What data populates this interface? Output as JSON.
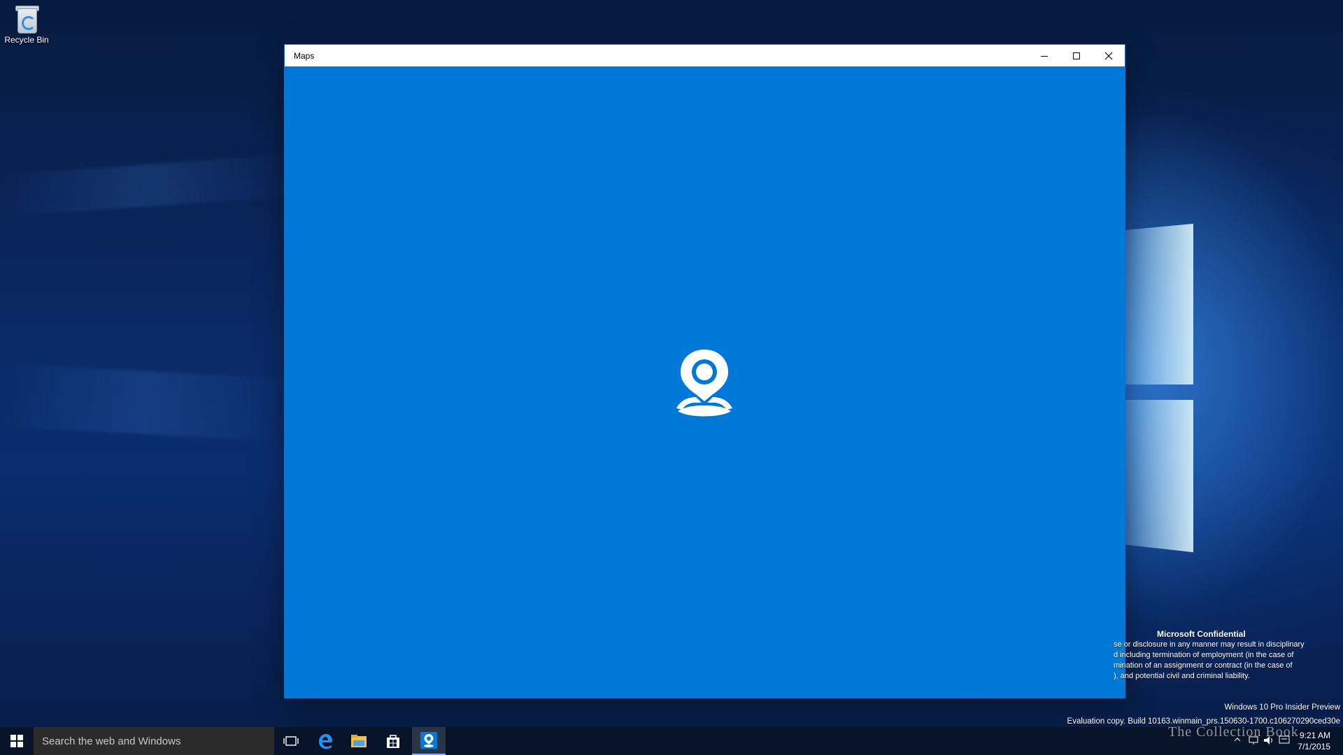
{
  "desktop": {
    "recycle_bin_label": "Recycle Bin"
  },
  "window": {
    "title": "Maps",
    "controls": {
      "minimize_icon": "minimize-icon",
      "maximize_icon": "maximize-icon",
      "close_icon": "close-icon"
    },
    "splash_icon": "maps-pin-icon",
    "accent_color": "#0078d7"
  },
  "confidential": {
    "heading": "Microsoft Confidential",
    "lines": [
      "se or disclosure in any manner may result in disciplinary",
      "d including termination of employment (in the case of",
      "mination of an assignment or contract (in the case of",
      "), and potential civil and criminal liability."
    ]
  },
  "evaluation": {
    "edition": "Windows 10 Pro Insider Preview",
    "build": "Evaluation copy. Build 10163.winmain_prs.150630-1700.c106270290ced30e"
  },
  "taskbar": {
    "search_placeholder": "Search the web and Windows",
    "pinned": [
      "task-view-icon",
      "edge-icon",
      "file-explorer-icon",
      "store-icon",
      "maps-icon"
    ],
    "clock_time": "9:21 AM",
    "clock_date": "7/1/2015"
  },
  "watermark": "The Collection Book"
}
